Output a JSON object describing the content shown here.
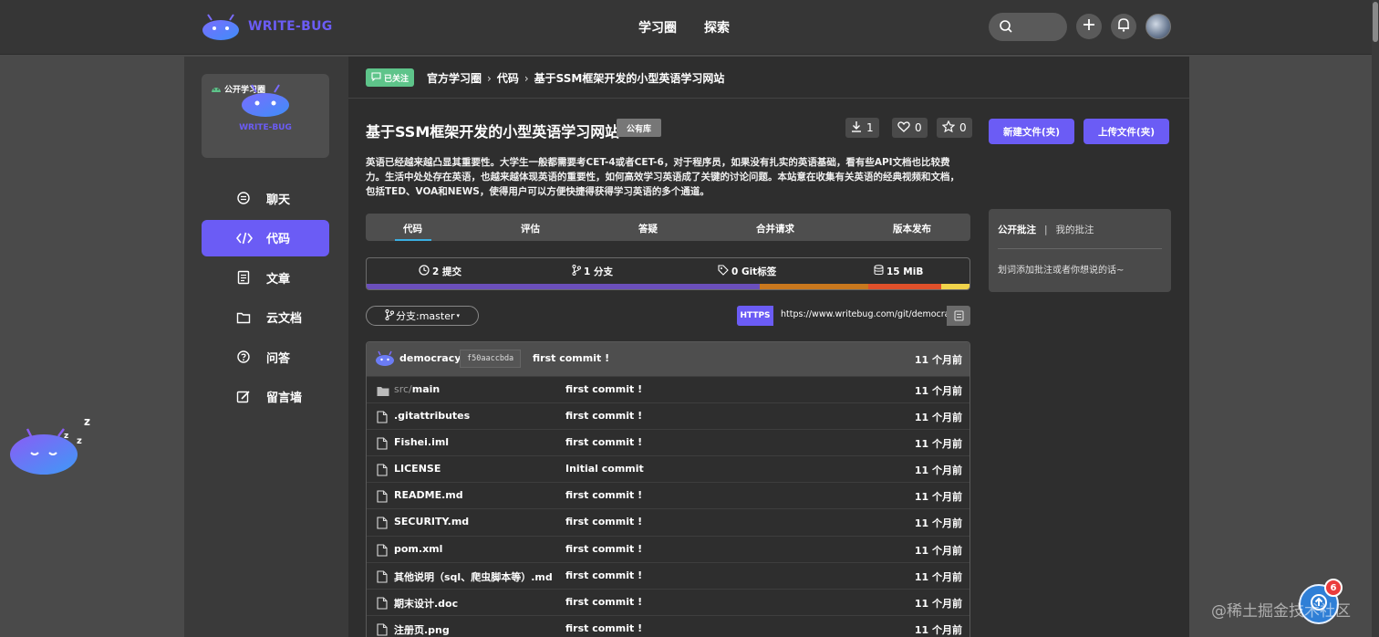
{
  "brand": {
    "name": "WRITE-BUG",
    "accent": "#6b5cf5"
  },
  "nav": {
    "items": [
      "学习圈",
      "探索"
    ]
  },
  "sidebar": {
    "group_tag": "公开学习圈",
    "group_name": "WRITE-BUG",
    "items": [
      {
        "label": "聊天",
        "icon": "chat-icon"
      },
      {
        "label": "代码",
        "icon": "code-icon",
        "active": true
      },
      {
        "label": "文章",
        "icon": "article-icon"
      },
      {
        "label": "云文档",
        "icon": "folder-icon"
      },
      {
        "label": "问答",
        "icon": "question-icon"
      },
      {
        "label": "留言墙",
        "icon": "edit-icon"
      }
    ]
  },
  "breadcrumb": {
    "follow_label": "已关注",
    "items": [
      "官方学习圈",
      "代码",
      "基于SSM框架开发的小型英语学习网站"
    ]
  },
  "repo": {
    "title": "基于SSM框架开发的小型英语学习网站",
    "visibility": "公有库",
    "downloads": "1",
    "likes": "0",
    "stars": "0",
    "description": "英语已经越来越凸显其重要性。大学生一般都需要考CET-4或者CET-6，对于程序员，如果没有扎实的英语基础，看有些API文档也比较费力。生活中处处存在英语，也越来越体现英语的重要性，如何高效学习英语成了关键的讨论问题。本站意在收集有关英语的经典视频和文档，包括TED、VOA和NEWS，使得用户可以方便快捷得获得学习英语的多个通道。"
  },
  "tabs": [
    "代码",
    "评估",
    "答疑",
    "合并请求",
    "版本发布"
  ],
  "stats": {
    "commits": "2 提交",
    "branches": "1 分支",
    "tags": "0 Git标签",
    "size": "15 MiB"
  },
  "language_bar": [
    {
      "color": "#6b4fbb",
      "share": 0.65
    },
    {
      "color": "#c9781e",
      "share": 0.18
    },
    {
      "color": "#e0502a",
      "share": 0.12
    },
    {
      "color": "#f0d34a",
      "share": 0.05
    }
  ],
  "branch": {
    "label": "分支:master"
  },
  "clone": {
    "protocol": "HTTPS",
    "url": "https://www.writebug.com/git/democracy"
  },
  "actions": {
    "new_file": "新建文件(夹)",
    "upload_file": "上传文件(夹)"
  },
  "latest_commit": {
    "owner": "democracy",
    "hash": "f50aaccbda",
    "message": "first commit !",
    "time": "11 个月前"
  },
  "files": [
    {
      "dim": "src/",
      "name": "main",
      "type": "folder",
      "message": "first commit !",
      "time": "11 个月前"
    },
    {
      "dim": "",
      "name": ".gitattributes",
      "type": "file",
      "message": "first commit !",
      "time": "11 个月前"
    },
    {
      "dim": "",
      "name": "Fishei.iml",
      "type": "file",
      "message": "first commit !",
      "time": "11 个月前"
    },
    {
      "dim": "",
      "name": "LICENSE",
      "type": "file",
      "message": "Initial commit",
      "time": "11 个月前"
    },
    {
      "dim": "",
      "name": "README.md",
      "type": "file",
      "message": "first commit !",
      "time": "11 个月前"
    },
    {
      "dim": "",
      "name": "SECURITY.md",
      "type": "file",
      "message": "first commit !",
      "time": "11 个月前"
    },
    {
      "dim": "",
      "name": "pom.xml",
      "type": "file",
      "message": "first commit !",
      "time": "11 个月前"
    },
    {
      "dim": "",
      "name": "其他说明（sql、爬虫脚本等）.md",
      "type": "file",
      "message": "first commit !",
      "time": "11 个月前"
    },
    {
      "dim": "",
      "name": "期末设计.doc",
      "type": "file",
      "message": "first commit !",
      "time": "11 个月前"
    },
    {
      "dim": "",
      "name": "注册页.png",
      "type": "file",
      "message": "first commit !",
      "time": "11 个月前"
    }
  ],
  "notes": {
    "public_tab": "公开批注",
    "separator": "|",
    "mine_tab": "我的批注",
    "hint": "划词添加批注或者你想说的话~"
  },
  "floating": {
    "badge_count": "6"
  },
  "watermark": "@稀土掘金技术社区"
}
